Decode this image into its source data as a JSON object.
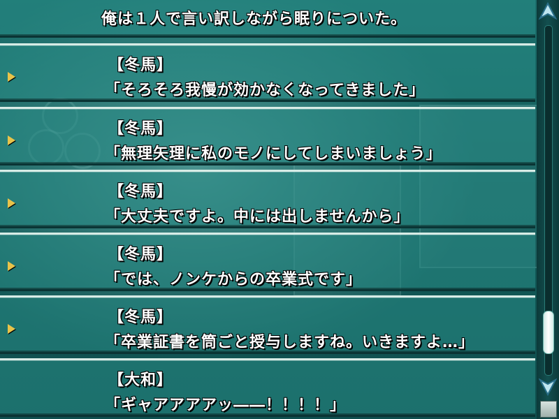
{
  "backlog": {
    "entries": [
      {
        "speaker": "",
        "line": "俺は１人で言い訳しながら眠りについた。",
        "has_voice": false
      },
      {
        "speaker": "【冬馬】",
        "line": "「そろそろ我慢が効かなくなってきました」",
        "has_voice": true
      },
      {
        "speaker": "【冬馬】",
        "line": "「無理矢理に私のモノにしてしまいましょう」",
        "has_voice": true
      },
      {
        "speaker": "【冬馬】",
        "line": "「大丈夫ですよ。中には出しませんから」",
        "has_voice": true
      },
      {
        "speaker": "【冬馬】",
        "line": "「では、ノンケからの卒業式です」",
        "has_voice": true
      },
      {
        "speaker": "【冬馬】",
        "line": "「卒業証書を筒ごと授与しますね。いきますよ…」",
        "has_voice": true
      },
      {
        "speaker": "【大和】",
        "line": "「ギャアアアアッ――！！！！」",
        "has_voice": false
      }
    ]
  },
  "scrollbar": {
    "position_fraction": 0.93,
    "up_icon": "chevron-up-icon",
    "down_icon": "chevron-down-icon",
    "close_icon": "square-button-icon"
  },
  "colors": {
    "panel": "#1f7f7a",
    "border_light": "#d7ece6",
    "voice_icon": "#e8c34a",
    "text": "#ffffff"
  }
}
